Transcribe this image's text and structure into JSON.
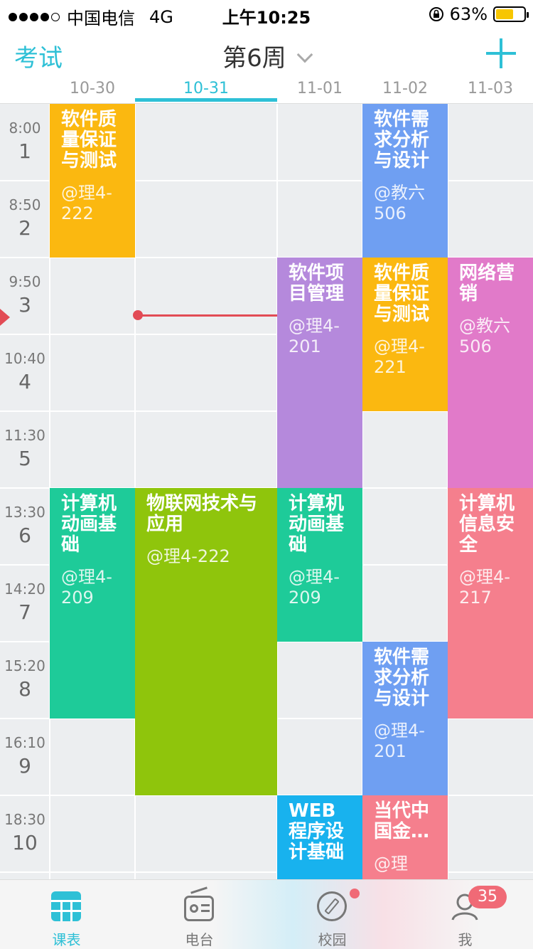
{
  "status_bar": {
    "carrier": "中国电信",
    "network": "4G",
    "time": "上午10:25",
    "battery": "63%",
    "battery_level": 0.63
  },
  "header": {
    "exam_label": "考试",
    "week_label": "第6周"
  },
  "dates": [
    "10-30",
    "10-31",
    "11-01",
    "11-02",
    "11-03"
  ],
  "active_date_index": 1,
  "slots": [
    {
      "time": "8:00",
      "num": "1"
    },
    {
      "time": "8:50",
      "num": "2"
    },
    {
      "time": "9:50",
      "num": "3"
    },
    {
      "time": "10:40",
      "num": "4"
    },
    {
      "time": "11:30",
      "num": "5"
    },
    {
      "time": "13:30",
      "num": "6"
    },
    {
      "time": "14:20",
      "num": "7"
    },
    {
      "time": "15:20",
      "num": "8"
    },
    {
      "time": "16:10",
      "num": "9"
    },
    {
      "time": "18:30",
      "num": "10"
    }
  ],
  "courses": [
    {
      "name": "软件质量保证与测试",
      "room": "@理4-222",
      "day": 0,
      "start": 1,
      "end": 2,
      "color": "#fbb810"
    },
    {
      "name": "软件需求分析与设计",
      "room": "@教六506",
      "day": 3,
      "start": 1,
      "end": 2,
      "color": "#6f9ff2"
    },
    {
      "name": "软件项目管理",
      "room": "@理4-201",
      "day": 2,
      "start": 3,
      "end": 5,
      "color": "#b589dc"
    },
    {
      "name": "软件质量保证与测试",
      "room": "@理4-221",
      "day": 3,
      "start": 3,
      "end": 4,
      "color": "#fbb810"
    },
    {
      "name": "网络营销",
      "room": "@教六506",
      "day": 4,
      "start": 3,
      "end": 5,
      "color": "#e17ac9"
    },
    {
      "name": "计算机动画基础",
      "room": "@理4-209",
      "day": 0,
      "start": 6,
      "end": 8,
      "color": "#1ecb99"
    },
    {
      "name": "物联网技术与应用",
      "room": "@理4-222",
      "day": 1,
      "start": 6,
      "end": 9,
      "color": "#8fc50c"
    },
    {
      "name": "计算机动画基础",
      "room": "@理4-209",
      "day": 2,
      "start": 6,
      "end": 7,
      "color": "#1ecb99"
    },
    {
      "name": "计算机信息安全",
      "room": "@理4-217",
      "day": 4,
      "start": 6,
      "end": 8,
      "color": "#f57f8d"
    },
    {
      "name": "软件需求分析与设计",
      "room": "@理4-201",
      "day": 3,
      "start": 8,
      "end": 9,
      "color": "#6f9ff2"
    },
    {
      "name": "WEB程序设计基础",
      "room": "",
      "day": 2,
      "start": 10,
      "end": 11,
      "color": "#18b2ee"
    },
    {
      "name": "当代中国金…",
      "room": "@理",
      "day": 3,
      "start": 10,
      "end": 11,
      "color": "#f57f8d"
    }
  ],
  "tabs": [
    {
      "label": "课表",
      "icon": "timetable-icon"
    },
    {
      "label": "电台",
      "icon": "radio-icon"
    },
    {
      "label": "校园",
      "icon": "compass-icon"
    },
    {
      "label": "我",
      "icon": "profile-icon"
    }
  ],
  "me_badge": "35",
  "colors": {
    "accent": "#2ec0d6",
    "now_line": "#e24b55",
    "badge": "#f06a76"
  }
}
